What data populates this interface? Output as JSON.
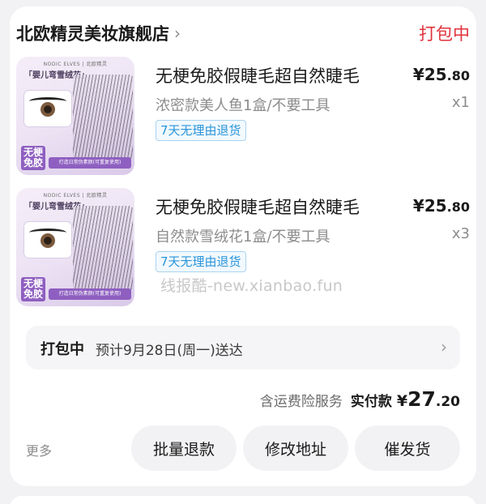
{
  "shop": {
    "name": "北欧精灵美妆旗舰店",
    "status": "打包中"
  },
  "items": [
    {
      "title": "无梗免胶假睫毛超自然睫毛",
      "price_int": "¥25",
      "price_dec": ".80",
      "variant": "浓密款美人鱼1盒/不要工具",
      "qty": "x1",
      "return_tag": "7天无理由退货",
      "thumb": {
        "brand": "NODIC ELVES | 北欧精灵",
        "series": "「婴儿弯雪绒花」",
        "tag": "无梗免胶",
        "banner": "打造日常伪素颜(可重复使用)"
      }
    },
    {
      "title": "无梗免胶假睫毛超自然睫毛",
      "price_int": "¥25",
      "price_dec": ".80",
      "variant": "自然款雪绒花1盒/不要工具",
      "qty": "x3",
      "return_tag": "7天无理由退货",
      "thumb": {
        "brand": "NODIC ELVES | 北欧精灵",
        "series": "「婴儿弯雪绒花」",
        "tag": "无梗免胶",
        "banner": "打造日常伪素颜(可重复使用)"
      }
    }
  ],
  "watermark": "线报酷-new.xianbao.fun",
  "delivery": {
    "status": "打包中",
    "eta": "预计9月28日(周一)送达"
  },
  "totals": {
    "insurance": "含运费险服务",
    "paid_label": "实付款",
    "currency": "¥",
    "amount_int": "27",
    "amount_dec": ".20"
  },
  "actions": {
    "more": "更多",
    "refund": "批量退款",
    "address": "修改地址",
    "urge": "催发货"
  },
  "colors": {
    "status_red": "#e0323b",
    "tag_blue": "#2b95d8"
  }
}
